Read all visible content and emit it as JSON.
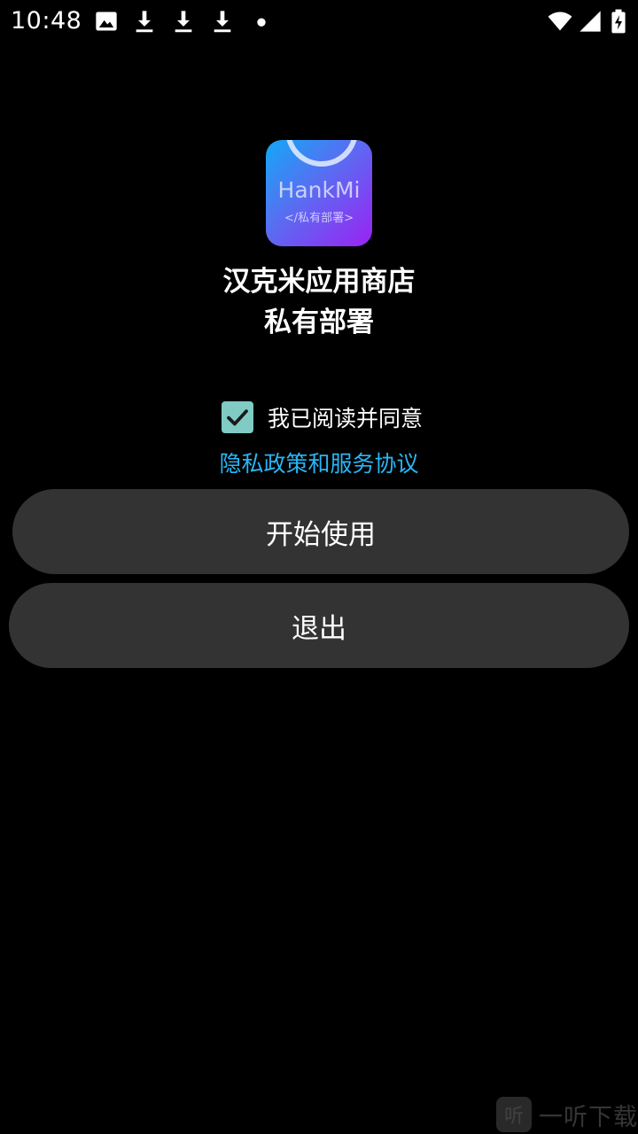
{
  "status_bar": {
    "time": "10:48",
    "left_icons": [
      "image-icon",
      "download-icon",
      "download-icon",
      "download-icon",
      "dot-icon"
    ],
    "right_icons": [
      "wifi-icon",
      "cell-signal-icon",
      "battery-charging-icon"
    ]
  },
  "logo": {
    "text": "HankMi",
    "subtext": "</私有部署>",
    "gradient": [
      "#13a8f6",
      "#5a6cf2",
      "#9b22f3"
    ]
  },
  "title": {
    "line1": "汉克米应用商店",
    "line2": "私有部署"
  },
  "agreement": {
    "checked": true,
    "label": "我已阅读并同意",
    "policy_link": "隐私政策和服务协议"
  },
  "buttons": {
    "start": "开始使用",
    "exit": "退出"
  },
  "watermark": {
    "glyph": "听",
    "text": "一听下载"
  },
  "colors": {
    "background": "#000000",
    "button_bg": "#333333",
    "checkbox": "#80cbc4",
    "link": "#29b6f6"
  }
}
